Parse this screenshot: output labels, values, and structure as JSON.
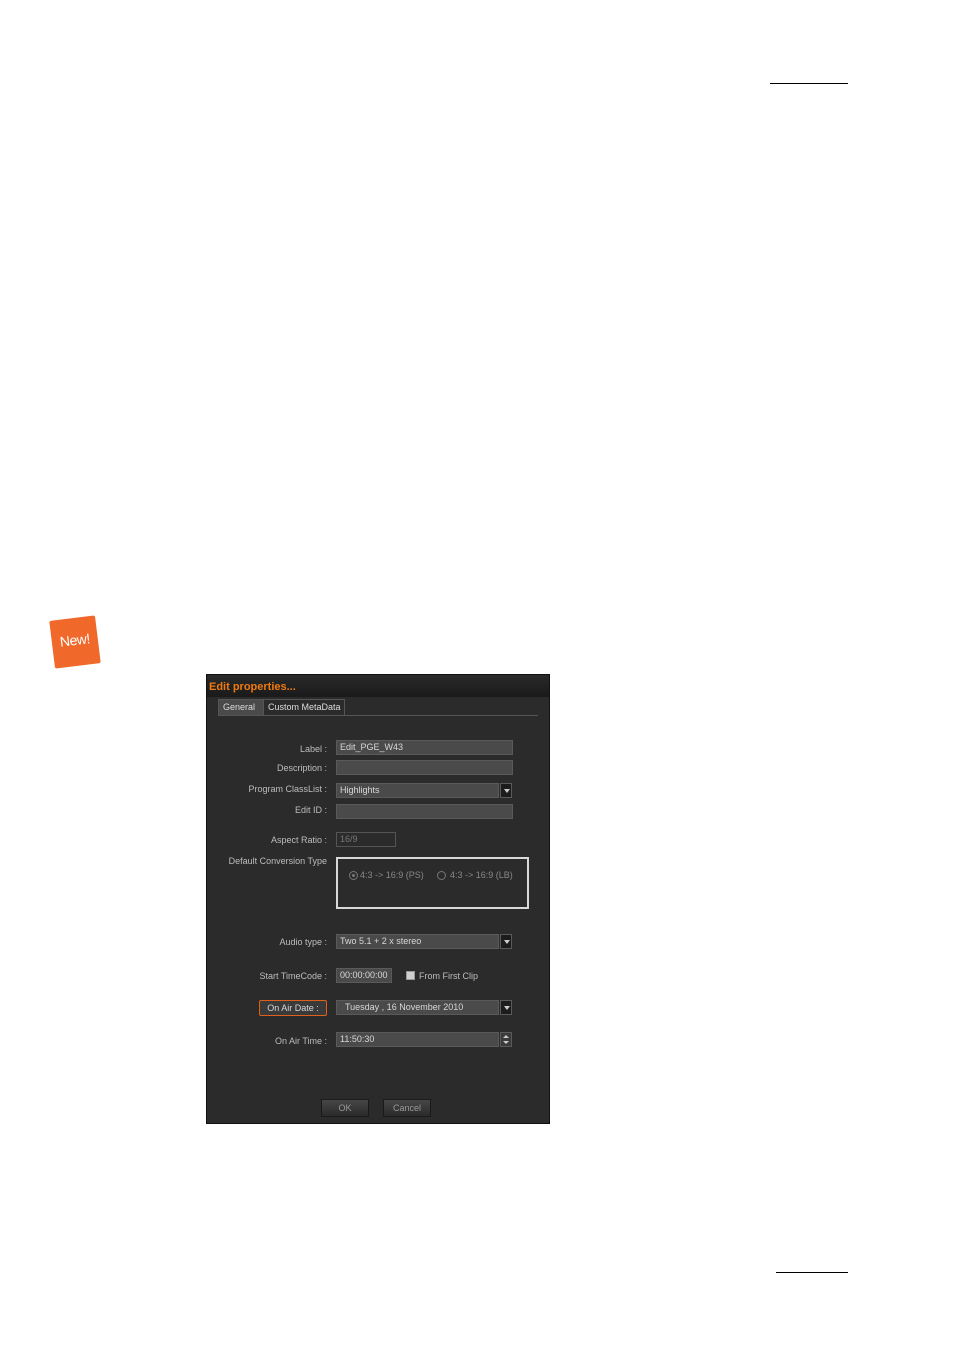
{
  "badge": {
    "text": "New!"
  },
  "dialog": {
    "title": "Edit properties...",
    "tabs": [
      {
        "label": "General"
      },
      {
        "label": "Custom MetaData"
      }
    ],
    "fields": {
      "label": {
        "label": "Label :",
        "value": "Edit_PGE_W43"
      },
      "description": {
        "label": "Description :",
        "value": ""
      },
      "program_classlist": {
        "label": "Program ClassList :",
        "value": "Highlights"
      },
      "edit_id": {
        "label": "Edit ID :",
        "value": ""
      },
      "aspect_ratio": {
        "label": "Aspect Ratio :",
        "value": "16/9"
      },
      "conversion": {
        "label": "Default Conversion Type",
        "options": [
          "4:3 -> 16:9 (PS)",
          "4:3 -> 16:9 (LB)"
        ],
        "selected": "4:3 -> 16:9 (PS)"
      },
      "audio_type": {
        "label": "Audio type :",
        "value": "Two 5.1 + 2 x stereo"
      },
      "start_timecode": {
        "label": "Start TimeCode :",
        "value": "00:00:00:00",
        "checkbox_label": "From First Clip",
        "checked": false
      },
      "on_air_date": {
        "label": "On Air Date :",
        "value": "Tuesday , 16 November 2010"
      },
      "on_air_time": {
        "label": "On Air Time :",
        "value": "11:50:30"
      }
    },
    "buttons": {
      "ok": "OK",
      "cancel": "Cancel"
    }
  },
  "colors": {
    "accent": "#f07a10",
    "badge": "#f0682a",
    "dialog_bg": "#2b2b2b"
  }
}
